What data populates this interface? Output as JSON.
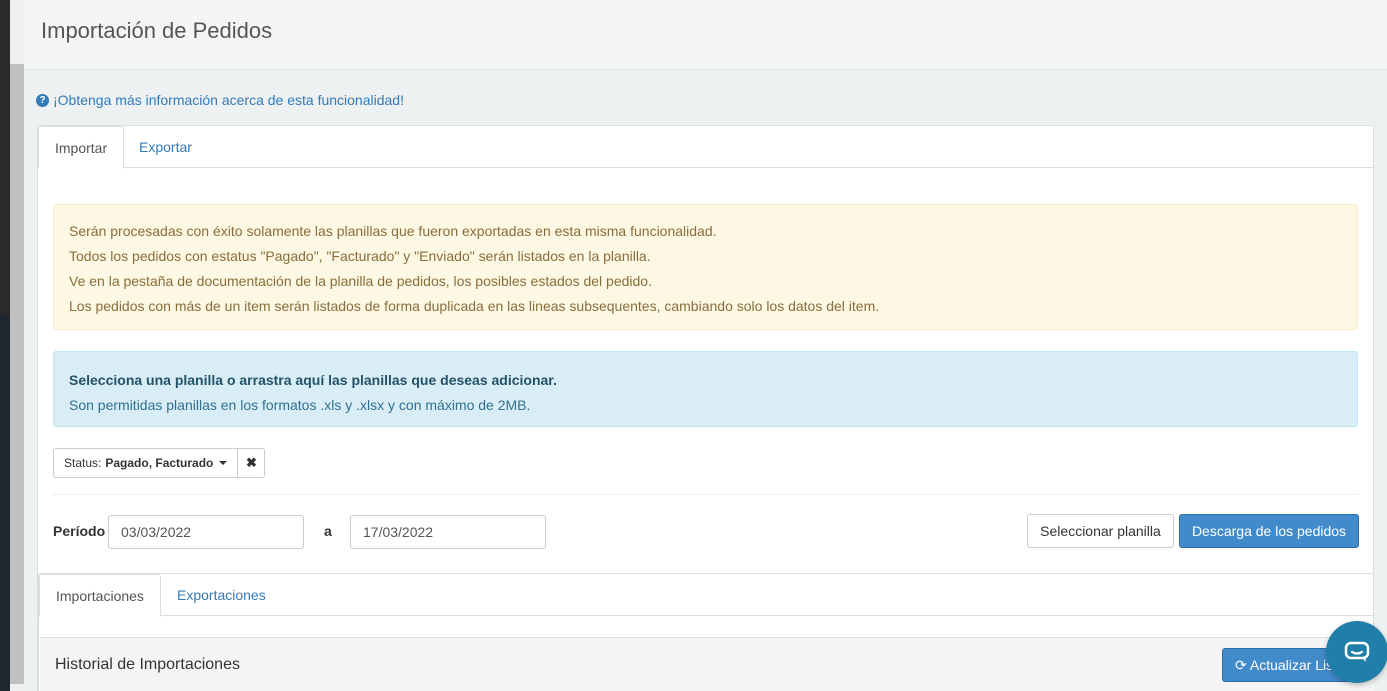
{
  "header": {
    "title": "Importación de Pedidos"
  },
  "help": {
    "link_text": "¡Obtenga más información acerca de esta funcionalidad!",
    "icon": "question-circle-icon"
  },
  "tabs": [
    {
      "label": "Importar",
      "active": true
    },
    {
      "label": "Exportar",
      "active": false
    }
  ],
  "warning": {
    "lines": [
      "Serán procesadas con éxito solamente las planillas que fueron exportadas en esta misma funcionalidad.",
      "Todos los pedidos con estatus \"Pagado\", \"Facturado\" y \"Enviado\" serán listados en la planilla.",
      "Ve en la pestaña de documentación de la planilla de pedidos, los posibles estados del pedido.",
      "Los pedidos con más de un item serán listados de forma duplicada en las lineas subsequentes, cambiando solo los datos del item."
    ]
  },
  "info": {
    "title": "Selecciona una planilla o arrastra aquí las planillas que deseas adicionar.",
    "text": "Son permitidas planillas en los formatos .xls y .xlsx y con máximo de 2MB."
  },
  "status_filter": {
    "label": "Status:",
    "value": "Pagado, Facturado",
    "clear_icon": "close-icon"
  },
  "period": {
    "label": "Período",
    "from": "03/03/2022",
    "separator": "a",
    "to": "17/03/2022"
  },
  "actions": {
    "select_label": "Seleccionar planilla",
    "download_label": "Descarga de los pedidos"
  },
  "sub_tabs": [
    {
      "label": "Importaciones",
      "active": true
    },
    {
      "label": "Exportaciones",
      "active": false
    }
  ],
  "history": {
    "title": "Historial de Importaciones",
    "refresh_label": "Actualizar Lista",
    "refresh_icon": "refresh-icon"
  },
  "colors": {
    "primary": "#428bca",
    "link": "#337ab7",
    "warning_bg": "#fcf8e3",
    "info_bg": "#d9edf7",
    "chat": "#1f7fa8"
  }
}
